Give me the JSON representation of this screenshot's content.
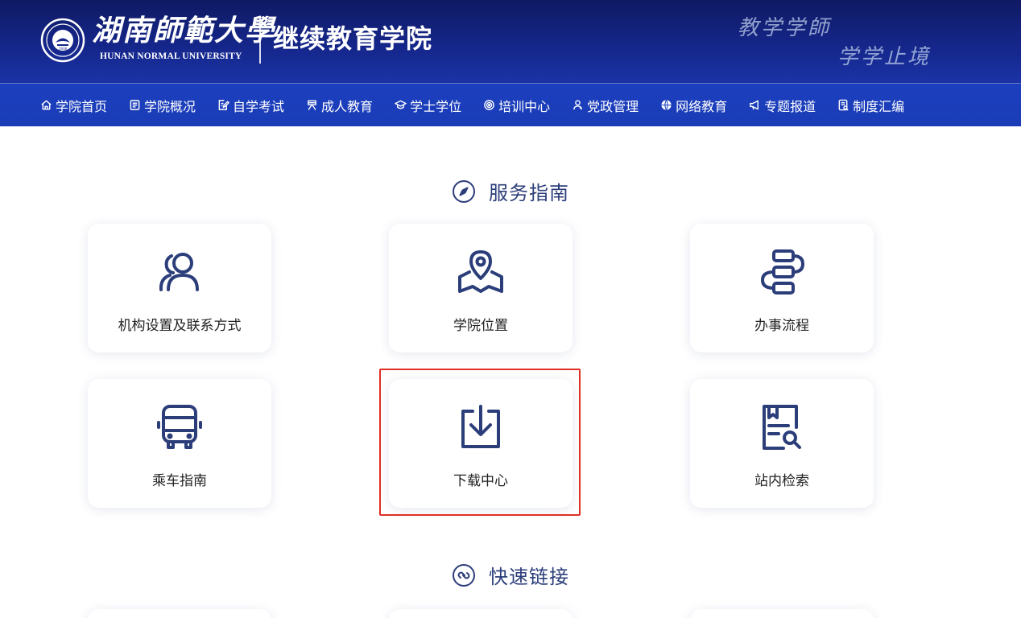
{
  "header": {
    "university_cn": "湖南師範大學",
    "university_en": "HUNAN NORMAL UNIVERSITY",
    "college": "继续教育学院",
    "motto_line1": "教学学師",
    "motto_line2": "学学止境"
  },
  "nav": {
    "items": [
      {
        "label": "学院首页",
        "icon": "home-icon"
      },
      {
        "label": "学院概况",
        "icon": "document-list-icon"
      },
      {
        "label": "自学考试",
        "icon": "edit-document-icon"
      },
      {
        "label": "成人教育",
        "icon": "adult-education-icon"
      },
      {
        "label": "学士学位",
        "icon": "graduation-cap-icon"
      },
      {
        "label": "培训中心",
        "icon": "target-icon"
      },
      {
        "label": "党政管理",
        "icon": "person-badge-icon"
      },
      {
        "label": "网络教育",
        "icon": "globe-icon"
      },
      {
        "label": "专题报道",
        "icon": "megaphone-icon"
      },
      {
        "label": "制度汇编",
        "icon": "regulation-book-icon"
      }
    ]
  },
  "service_guide": {
    "title": "服务指南",
    "icon": "compass-icon",
    "cards": [
      {
        "label": "机构设置及联系方式",
        "icon": "people-icon"
      },
      {
        "label": "学院位置",
        "icon": "map-location-icon"
      },
      {
        "label": "办事流程",
        "icon": "process-flow-icon"
      },
      {
        "label": "乘车指南",
        "icon": "bus-icon"
      },
      {
        "label": "下载中心",
        "icon": "download-icon"
      },
      {
        "label": "站内检索",
        "icon": "document-search-icon"
      }
    ]
  },
  "quick_links": {
    "title": "快速链接",
    "icon": "link-icon"
  },
  "colors": {
    "header_dark": "#0f1a63",
    "nav_blue": "#1c3fbf",
    "icon_navy": "#2c3e7a",
    "highlight_red": "#e02e24"
  }
}
